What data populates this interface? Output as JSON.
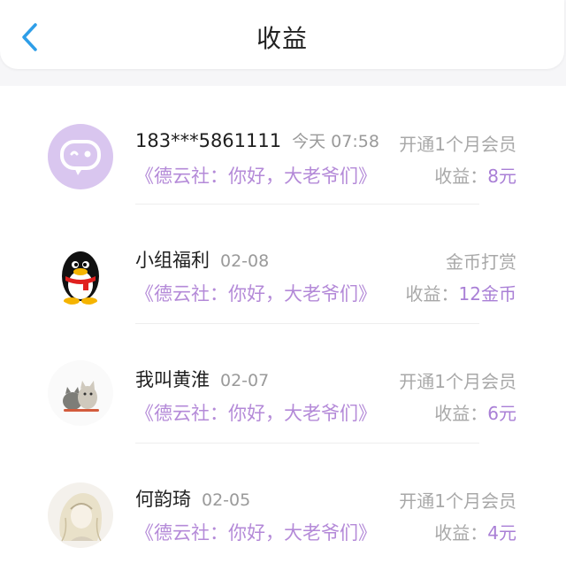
{
  "header": {
    "title": "收益"
  },
  "colors": {
    "accent": "#a97fd6",
    "back": "#2e9ee8"
  },
  "records": [
    {
      "name": "183***5861111",
      "time": "今天 07:58",
      "book": "《德云社：你好，大老爷们》",
      "action": "开通1个月会员",
      "earning_label": "收益：",
      "earning_value": "8元",
      "avatar_icon": "chat-bubble-avatar-icon"
    },
    {
      "name": "小组福利",
      "time": "02-08",
      "book": "《德云社：你好，大老爷们》",
      "action": "金币打赏",
      "earning_label": "收益：",
      "earning_value": "12金币",
      "avatar_icon": "penguin-avatar-icon"
    },
    {
      "name": "我叫黄淮",
      "time": "02-07",
      "book": "《德云社：你好，大老爷们》",
      "action": "开通1个月会员",
      "earning_label": "收益：",
      "earning_value": "6元",
      "avatar_icon": "cats-avatar-icon"
    },
    {
      "name": "何韵琦",
      "time": "02-05",
      "book": "《德云社：你好，大老爷们》",
      "action": "开通1个月会员",
      "earning_label": "收益：",
      "earning_value": "4元",
      "avatar_icon": "sketch-girl-avatar-icon"
    }
  ]
}
